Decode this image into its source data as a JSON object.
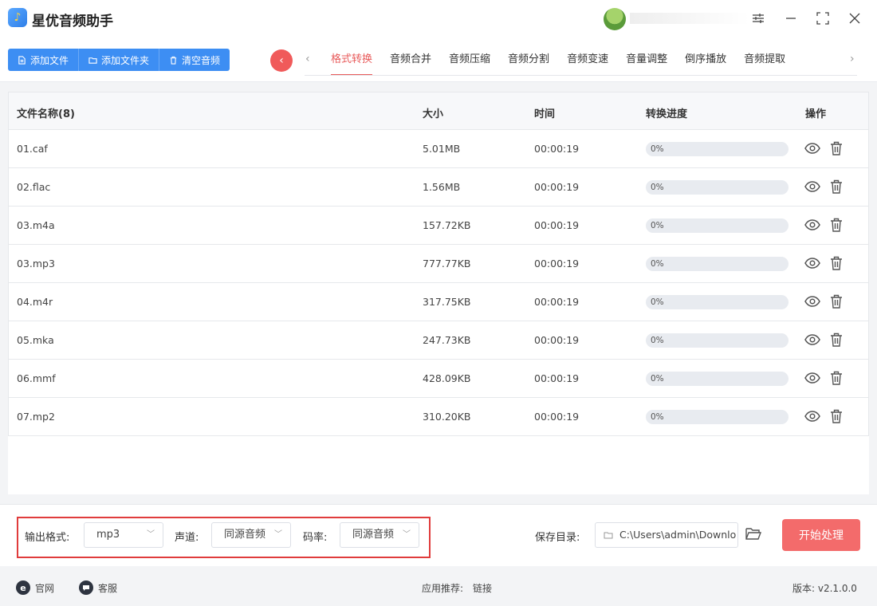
{
  "app": {
    "title": "星优音频助手",
    "logo_glyph": "♪"
  },
  "toolbar": {
    "add_file": "添加文件",
    "add_folder": "添加文件夹",
    "clear": "清空音频",
    "collapse_glyph": "‹",
    "prev_glyph": "‹",
    "next_glyph": "›"
  },
  "tabs": [
    "格式转换",
    "音频合并",
    "音频压缩",
    "音频分割",
    "音频变速",
    "音量调整",
    "倒序播放",
    "音频提取"
  ],
  "active_tab": 0,
  "table": {
    "headers": {
      "name": "文件名称(8)",
      "size": "大小",
      "time": "时间",
      "progress": "转换进度",
      "actions": "操作"
    },
    "rows": [
      {
        "name": "01.caf",
        "size": "5.01MB",
        "time": "00:00:19",
        "progress": "0%",
        "progress_value": 0
      },
      {
        "name": "02.flac",
        "size": "1.56MB",
        "time": "00:00:19",
        "progress": "0%",
        "progress_value": 0
      },
      {
        "name": "03.m4a",
        "size": "157.72KB",
        "time": "00:00:19",
        "progress": "0%",
        "progress_value": 0
      },
      {
        "name": "03.mp3",
        "size": "777.77KB",
        "time": "00:00:19",
        "progress": "0%",
        "progress_value": 0
      },
      {
        "name": "04.m4r",
        "size": "317.75KB",
        "time": "00:00:19",
        "progress": "0%",
        "progress_value": 0
      },
      {
        "name": "05.mka",
        "size": "247.73KB",
        "time": "00:00:19",
        "progress": "0%",
        "progress_value": 0
      },
      {
        "name": "06.mmf",
        "size": "428.09KB",
        "time": "00:00:19",
        "progress": "0%",
        "progress_value": 0
      },
      {
        "name": "07.mp2",
        "size": "310.20KB",
        "time": "00:00:19",
        "progress": "0%",
        "progress_value": 0
      }
    ]
  },
  "settings": {
    "format_label": "输出格式:",
    "format_value": "mp3",
    "channel_label": "声道:",
    "channel_value": "同源音频",
    "bitrate_label": "码率:",
    "bitrate_value": "同源音频",
    "save_label": "保存目录:",
    "save_path": "C:\\Users\\admin\\Downlo",
    "start_button": "开始处理"
  },
  "footer": {
    "website": "官网",
    "website_icon_glyph": "e",
    "support": "客服",
    "recommend": "应用推荐:",
    "link": "链接",
    "version": "版本:  v2.1.0.0"
  },
  "colors": {
    "accent_blue": "#3d8ef3",
    "accent_red": "#f36b6b",
    "highlight_red": "#e03c3c"
  }
}
